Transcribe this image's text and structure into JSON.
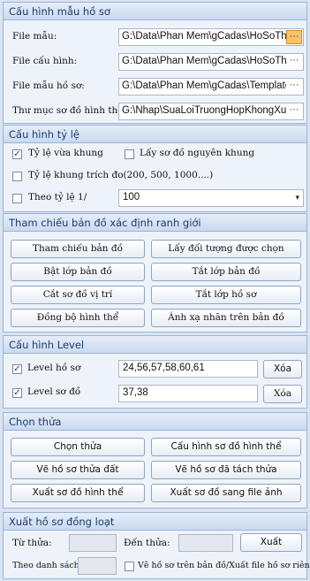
{
  "file_section": {
    "title": "Cấu hình mẫu hồ sơ",
    "rows": [
      {
        "label": "File mẫu:",
        "value": "G:\\Data\\Phan Mem\\gCadas\\HoSoThua",
        "button": "···"
      },
      {
        "label": "File cấu hình:",
        "value": "G:\\Data\\Phan Mem\\gCadas\\HoSoThua",
        "button": "···"
      },
      {
        "label": "File mẫu hồ sơ:",
        "value": "G:\\Data\\Phan Mem\\gCadas\\Template",
        "button": "···"
      },
      {
        "label": "Thư mục sơ đồ hình thể:",
        "value": "G:\\Nhap\\SuaLoiTruongHopKhongXuat",
        "button": "···"
      }
    ]
  },
  "ratio_section": {
    "title": "Cấu hình tỷ lệ",
    "fit_frame": {
      "label": "Tỷ lệ vừa khung",
      "checked": true,
      "mark": "✓"
    },
    "original_frame": {
      "label": "Lấy sơ đồ nguyên khung",
      "checked": false
    },
    "survey_frame": {
      "label": "Tỷ lệ khung trích đo(200, 500, 1000....)",
      "checked": false
    },
    "by_ratio": {
      "label": "Theo tỷ lệ 1/",
      "checked": false
    },
    "ratio_value": "100",
    "ratio_arrow": "▾"
  },
  "map_section": {
    "title": "Tham chiếu bản đồ xác định ranh giới",
    "buttons": [
      "Tham chiếu bản đồ",
      "Lấy đối tượng được chọn",
      "Bật lớp bản đồ",
      "Tắt lớp bản đồ",
      "Cắt sơ đồ vị trí",
      "Tắt lớp hồ sơ",
      "Đồng bộ hình thể",
      "Ánh xạ nhãn trên bản đồ"
    ]
  },
  "level_section": {
    "title": "Cấu hình Level",
    "profile": {
      "label": "Level hồ sơ",
      "checked": true,
      "mark": "✓",
      "value": "24,56,57,58,60,61",
      "button": "Xóa"
    },
    "diagram": {
      "label": "Level sơ đồ",
      "checked": true,
      "mark": "✓",
      "value": "37,38",
      "button": "Xóa"
    }
  },
  "parcel_section": {
    "title": "Chọn thửa",
    "buttons": [
      "Chọn thửa",
      "Cấu hình sơ đồ hình thể",
      "Vẽ hồ sơ thửa đất",
      "Vẽ hồ sơ đã tách thửa",
      "Xuất sơ đồ hình thể",
      "Xuất sơ đồ sang file ảnh"
    ]
  },
  "export_section": {
    "title": "Xuất hồ sơ đồng loạt",
    "from_label": "Từ thửa:",
    "from_value": "",
    "to_label": "Đến thửa:",
    "to_value": "",
    "export_button": "Xuất",
    "list_label": "Theo danh sách:",
    "list_value": "",
    "draw_on_map": {
      "label": "Vẽ hồ sơ trên bản đồ/Xuất file hồ sơ riêng",
      "checked": false
    }
  }
}
